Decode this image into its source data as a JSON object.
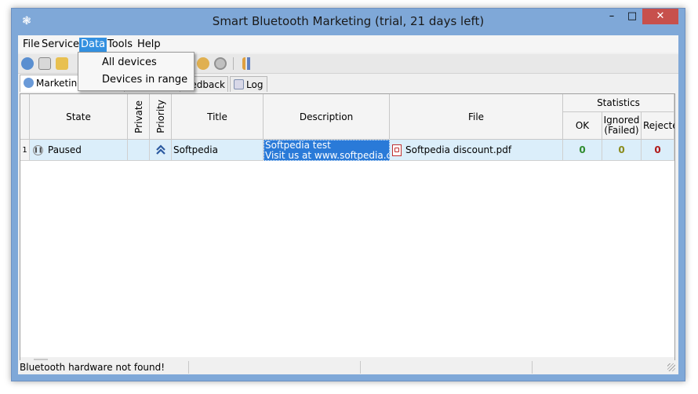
{
  "window": {
    "title": "Smart Bluetooth Marketing (trial, 21 days left)",
    "app_icon": "bluetooth-icon",
    "controls": {
      "minimize": "–",
      "maximize": "□",
      "close": "✕"
    }
  },
  "menu": {
    "items": [
      "File",
      "Services",
      "Data",
      "Tools",
      "Help"
    ],
    "active": "Data"
  },
  "dropdown": {
    "items": [
      "All devices",
      "Devices in range"
    ]
  },
  "tabs": [
    {
      "label": "Marketing",
      "icon": "radar-icon",
      "active": true
    },
    {
      "label": "eedback",
      "icon": "feedback-icon",
      "active": false
    },
    {
      "label": "Log",
      "icon": "log-icon",
      "active": false
    }
  ],
  "grid": {
    "headers": {
      "state": "State",
      "private": "Private",
      "priority": "Priority",
      "title": "Title",
      "description": "Description",
      "file": "File",
      "statistics": "Statistics",
      "ok": "OK",
      "ignored": "Ignored (Failed)",
      "rejected": "Rejecte"
    },
    "rows": [
      {
        "index": "1",
        "state": "Paused",
        "state_icon": "pause-icon",
        "priority_icon": "double-chevron-up-icon",
        "title": "Softpedia",
        "description_line1": "Softpedia test",
        "description_line2": "Visit us at www.softpedia.com",
        "file_icon": "pdf-file-icon",
        "file": "Softpedia discount.pdf",
        "ok": "0",
        "ignored": "0",
        "rejected": "0"
      }
    ]
  },
  "scroll": {
    "left": "<",
    "right": ">"
  },
  "status": {
    "message": "Bluetooth hardware not found!"
  },
  "colors": {
    "titlebar": "#7fa8d8",
    "menu_highlight": "#3390e0",
    "row_selected": "#dbeefa",
    "cell_selected": "#2a7ad8",
    "ok_green": "#2e8b2e",
    "ignored_olive": "#8a8a1a",
    "rejected_red": "#b01818",
    "close_button": "#c7504c"
  }
}
